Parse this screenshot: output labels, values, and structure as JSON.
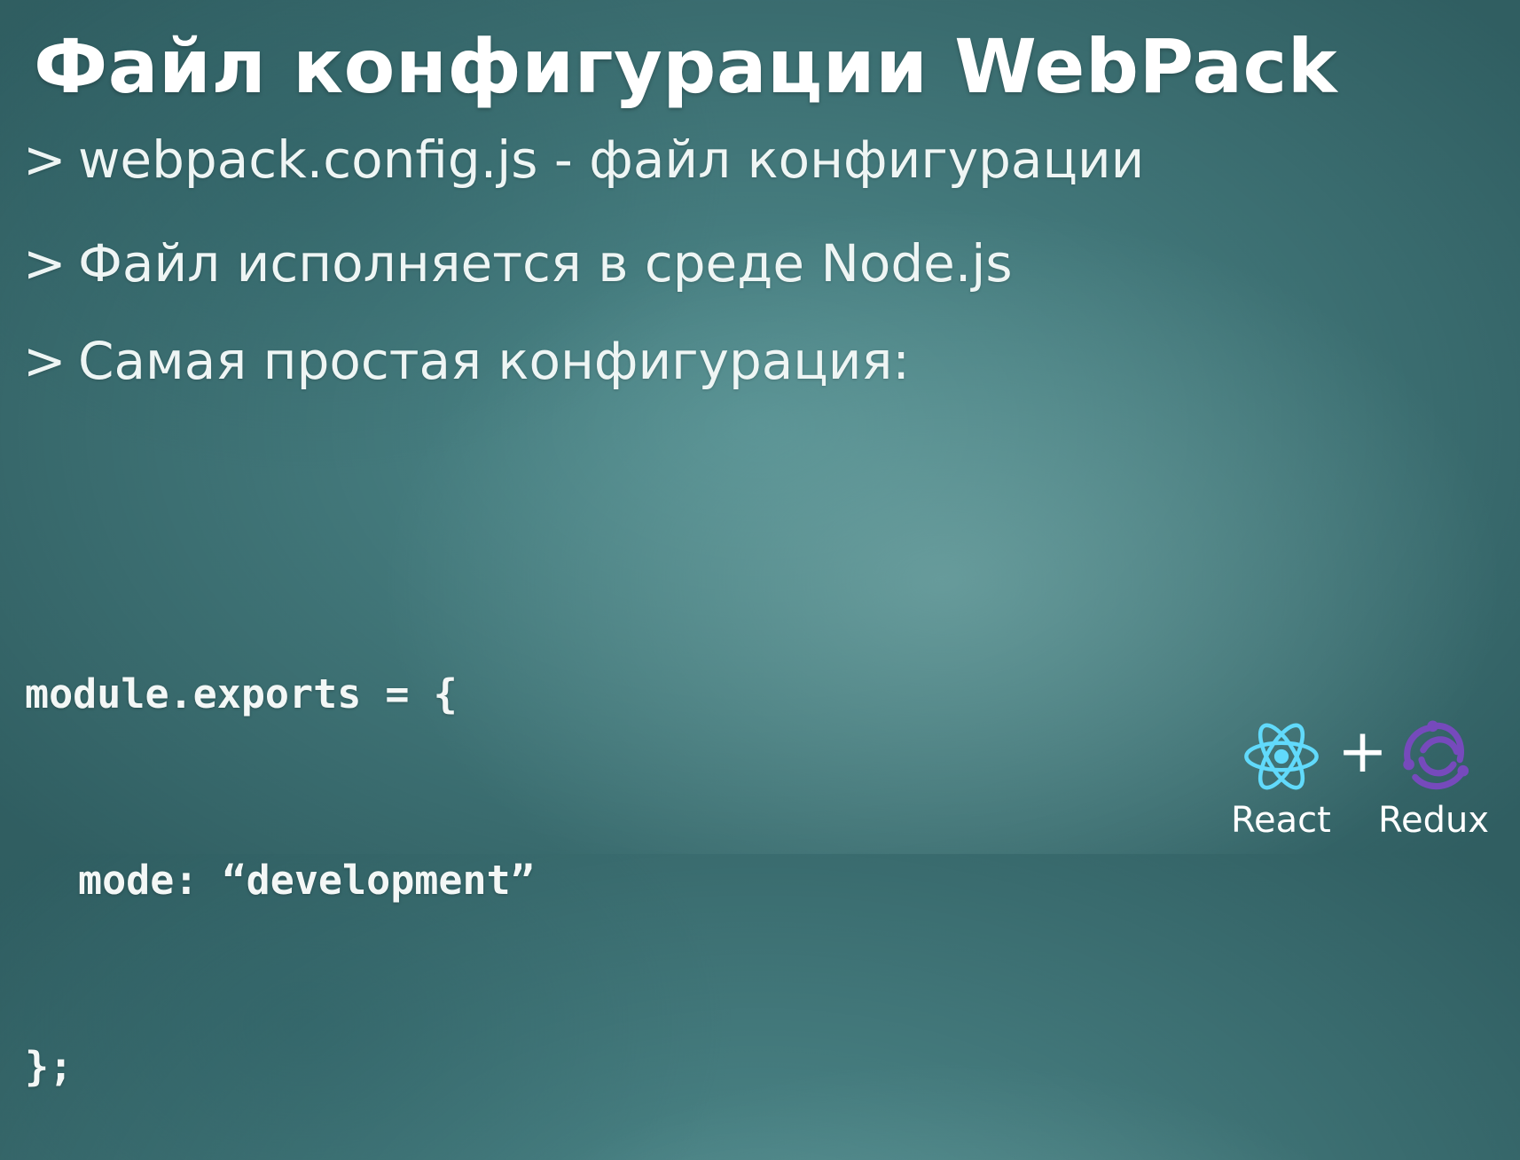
{
  "slide": {
    "title": "Файл конфигурации WebPack",
    "bullet_marker": ">",
    "bullets": [
      "webpack.config.js - файл конфигурации",
      "Файл исполняется в среде Node.js",
      "Самая простая конфигурация:"
    ],
    "code_lines": [
      "module.exports = {",
      "mode: “development”",
      "};"
    ]
  },
  "branding": {
    "left_logo": "react-icon",
    "left_label": "React",
    "separator": "+",
    "right_logo": "redux-icon",
    "right_label": "Redux"
  },
  "colors": {
    "background": "#4f8a8c",
    "text": "#ffffff",
    "react_logo": "#61dafb",
    "redux_logo": "#764abc"
  }
}
